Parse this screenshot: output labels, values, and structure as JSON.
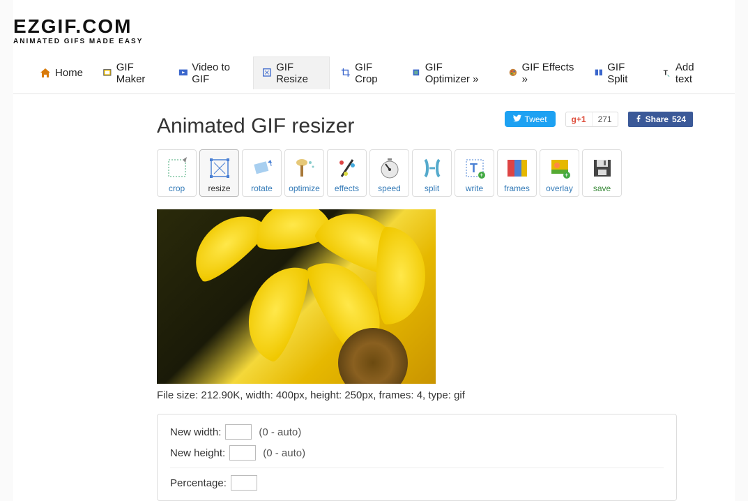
{
  "logo": {
    "main": "EZGIF.COM",
    "sub": "ANIMATED GIFS MADE EASY"
  },
  "nav": [
    {
      "label": "Home",
      "icon": "home-icon"
    },
    {
      "label": "GIF Maker",
      "icon": "maker-icon"
    },
    {
      "label": "Video to GIF",
      "icon": "video-icon"
    },
    {
      "label": "GIF Resize",
      "icon": "resize-icon"
    },
    {
      "label": "GIF Crop",
      "icon": "crop-icon"
    },
    {
      "label": "GIF Optimizer »",
      "icon": "optimize-icon"
    },
    {
      "label": "GIF Effects »",
      "icon": "effects-icon"
    },
    {
      "label": "GIF Split",
      "icon": "split-icon"
    },
    {
      "label": "Add text",
      "icon": "text-icon"
    }
  ],
  "social": {
    "tweet": "Tweet",
    "gplus_label": "+1",
    "gplus_count": "271",
    "fb_label": "Share",
    "fb_count": "524"
  },
  "page_title": "Animated GIF resizer",
  "tools": [
    {
      "label": "crop",
      "name": "crop"
    },
    {
      "label": "resize",
      "name": "resize"
    },
    {
      "label": "rotate",
      "name": "rotate"
    },
    {
      "label": "optimize",
      "name": "optimize"
    },
    {
      "label": "effects",
      "name": "effects"
    },
    {
      "label": "speed",
      "name": "speed"
    },
    {
      "label": "split",
      "name": "split"
    },
    {
      "label": "write",
      "name": "write"
    },
    {
      "label": "frames",
      "name": "frames"
    },
    {
      "label": "overlay",
      "name": "overlay"
    },
    {
      "label": "save",
      "name": "save"
    }
  ],
  "file_info": "File size: 212.90K, width: 400px, height: 250px, frames: 4, type: gif",
  "form": {
    "width_label": "New width:",
    "width_hint": "(0 - auto)",
    "height_label": "New height:",
    "height_hint": "(0 - auto)",
    "percentage_label": "Percentage:"
  }
}
